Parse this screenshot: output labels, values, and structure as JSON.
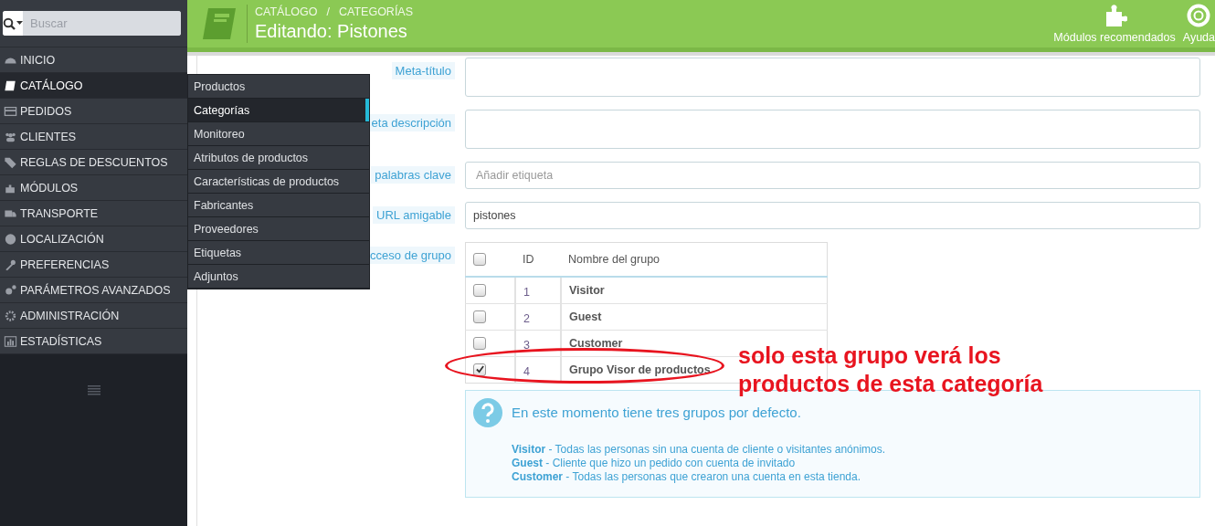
{
  "search": {
    "placeholder": "Buscar"
  },
  "sidebar": {
    "items": [
      {
        "label": "INICIO",
        "selected": false
      },
      {
        "label": "CATÁLOGO",
        "selected": true
      },
      {
        "label": "PEDIDOS",
        "selected": false
      },
      {
        "label": "CLIENTES",
        "selected": false
      },
      {
        "label": "REGLAS DE DESCUENTOS",
        "selected": false
      },
      {
        "label": "MÓDULOS",
        "selected": false
      },
      {
        "label": "TRANSPORTE",
        "selected": false
      },
      {
        "label": "LOCALIZACIÓN",
        "selected": false
      },
      {
        "label": "PREFERENCIAS",
        "selected": false
      },
      {
        "label": "PARÁMETROS AVANZADOS",
        "selected": false
      },
      {
        "label": "ADMINISTRACIÓN",
        "selected": false
      },
      {
        "label": "ESTADÍSTICAS",
        "selected": false
      }
    ]
  },
  "submenu": {
    "items": [
      {
        "label": "Productos",
        "selected": false
      },
      {
        "label": "Categorías",
        "selected": true
      },
      {
        "label": "Monitoreo",
        "selected": false
      },
      {
        "label": "Atributos de productos",
        "selected": false
      },
      {
        "label": "Características de productos",
        "selected": false
      },
      {
        "label": "Fabricantes",
        "selected": false
      },
      {
        "label": "Proveedores",
        "selected": false
      },
      {
        "label": "Etiquetas",
        "selected": false
      },
      {
        "label": "Adjuntos",
        "selected": false
      }
    ]
  },
  "header": {
    "breadcrumb": [
      "CATÁLOGO",
      "CATEGORÍAS"
    ],
    "separator": "/",
    "title": "Editando: Pistones",
    "actions": [
      {
        "label": "Módulos recomendados"
      },
      {
        "label": "Ayuda"
      }
    ]
  },
  "form": {
    "fields": [
      {
        "label": "Meta-título",
        "kind": "textarea"
      },
      {
        "label": "eta descripción",
        "kind": "textarea"
      },
      {
        "label": "palabras clave",
        "kind": "tags",
        "placeholder": "Añadir etiqueta"
      },
      {
        "label": "URL amigable",
        "kind": "text",
        "value": "pistones"
      },
      {
        "label": "cceso de grupo",
        "kind": "groups"
      }
    ]
  },
  "groups_table": {
    "header_checked": false,
    "columns": [
      "ID",
      "Nombre del grupo"
    ],
    "rows": [
      {
        "id": "1",
        "name": "Visitor",
        "checked": false
      },
      {
        "id": "2",
        "name": "Guest",
        "checked": false
      },
      {
        "id": "3",
        "name": "Customer",
        "checked": false
      },
      {
        "id": "4",
        "name": "Grupo Visor de productos",
        "checked": true
      }
    ]
  },
  "annotation": {
    "lines": [
      "solo esta grupo verá los",
      "productos de esta categoría"
    ]
  },
  "info": {
    "title": "En este momento tiene tres grupos por defecto.",
    "lines": [
      "**Visitor** - Todas las personas sin una cuenta de cliente o visitantes anónimos.",
      "**Guest** - Cliente que hizo un pedido con cuenta de invitado",
      "**Customer** - Todas las personas que crearon una cuenta en esta tienda."
    ]
  }
}
